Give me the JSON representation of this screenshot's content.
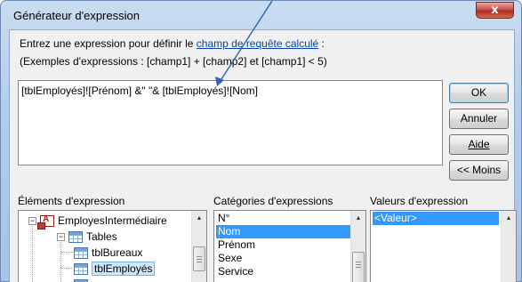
{
  "window": {
    "title": "Générateur d'expression",
    "close_label": "x"
  },
  "instructions": {
    "line1_prefix": "Entrez une expression pour définir le ",
    "line1_link": "champ de requête calculé",
    "line1_suffix": " :",
    "line2": "(Exemples d'expressions : [champ1] + [champ2] et [champ1] < 5)"
  },
  "expression": {
    "value": "[tblEmployés]![Prénom] &\" \"& [tblEmployés]![Nom]"
  },
  "buttons": {
    "ok": "OK",
    "cancel": "Annuler",
    "help": "Aide",
    "less": "<< Moins"
  },
  "sections": {
    "elements": "Éléments d'expression",
    "categories": "Catégories d'expressions",
    "values": "Valeurs d'expression"
  },
  "tree": {
    "root": "EmployesIntermédiaire",
    "tables": "Tables",
    "items": [
      "tblBureaux",
      "tblEmployés"
    ]
  },
  "categories": {
    "items": [
      "N°",
      "Nom",
      "Prénom",
      "Sexe",
      "Service"
    ],
    "selected_index": 1
  },
  "values": {
    "items": [
      "<Valeur>"
    ]
  },
  "colors": {
    "selection": "#3399ff",
    "annotation_arrow": "#2e62b8"
  }
}
